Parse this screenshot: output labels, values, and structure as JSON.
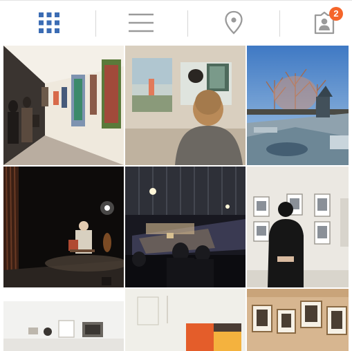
{
  "tabs": [
    {
      "id": "grid",
      "icon": "grid-icon",
      "active": true
    },
    {
      "id": "list",
      "icon": "list-icon",
      "active": false
    },
    {
      "id": "places",
      "icon": "location-pin-icon",
      "active": false
    },
    {
      "id": "tagged",
      "icon": "tagged-person-icon",
      "active": false,
      "badge": "2"
    }
  ],
  "colors": {
    "active_icon": "#3b6cb4",
    "inactive_icon": "#9a9a9a",
    "badge": "#f5652a"
  },
  "photos": [
    {
      "subject": "gallery-corridor"
    },
    {
      "subject": "woman-viewing-paintings"
    },
    {
      "subject": "plaza-fountain-sunset"
    },
    {
      "subject": "performer-on-stage"
    },
    {
      "subject": "audience-concert-stage"
    },
    {
      "subject": "man-viewing-framed-prints"
    },
    {
      "subject": "white-room-frames"
    },
    {
      "subject": "minimal-artwork"
    },
    {
      "subject": "framed-photos-wall"
    }
  ]
}
